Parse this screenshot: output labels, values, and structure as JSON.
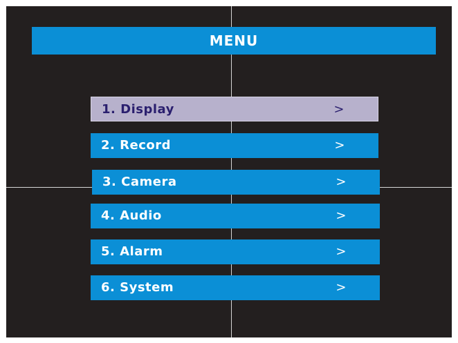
{
  "title": "MENU",
  "items": [
    {
      "label": "1. Display",
      "arrow": ">",
      "selected": true
    },
    {
      "label": "2. Record",
      "arrow": ">",
      "selected": false
    },
    {
      "label": "3. Camera",
      "arrow": ">",
      "selected": false
    },
    {
      "label": "4. Audio",
      "arrow": ">",
      "selected": false
    },
    {
      "label": "5. Alarm",
      "arrow": ">",
      "selected": false
    },
    {
      "label": "6. System",
      "arrow": ">",
      "selected": false
    }
  ],
  "colors": {
    "background": "#231f1f",
    "accent": "#0b8fd6",
    "selected_background": "#b7b1cc",
    "selected_text": "#2a1f6e",
    "crosshair": "#d8d8d8"
  }
}
